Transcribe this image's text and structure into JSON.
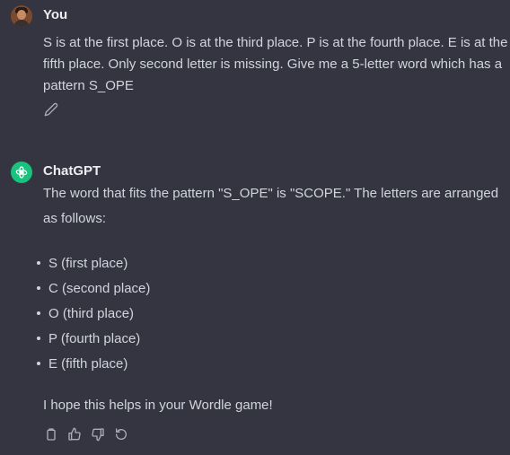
{
  "user_message": {
    "author": "You",
    "text": "S is at the first place. O is at the third place. P is at the fourth place. E is at the fifth place. Only second letter is missing. Give me a 5-letter word which has a pattern S_OPE"
  },
  "assistant_message": {
    "author": "ChatGPT",
    "intro": "The word that fits the pattern \"S_OPE\" is \"SCOPE.\" The letters are arranged as follows:",
    "points": [
      "S (first place)",
      "C (second place)",
      "O (third place)",
      "P (fourth place)",
      "E (fifth place)"
    ],
    "closing": "I hope this helps in your Wordle game!"
  },
  "icons": {
    "user_avatar": "user-avatar-photo",
    "assistant_avatar": "openai-logo-icon",
    "edit": "pencil-icon",
    "actions": [
      "copy-icon",
      "thumbs-up-icon",
      "thumbs-down-icon",
      "regenerate-icon"
    ]
  },
  "colors": {
    "background": "#343541",
    "assistant_avatar_bg": "#19c37d",
    "text": "#d1d5db"
  }
}
